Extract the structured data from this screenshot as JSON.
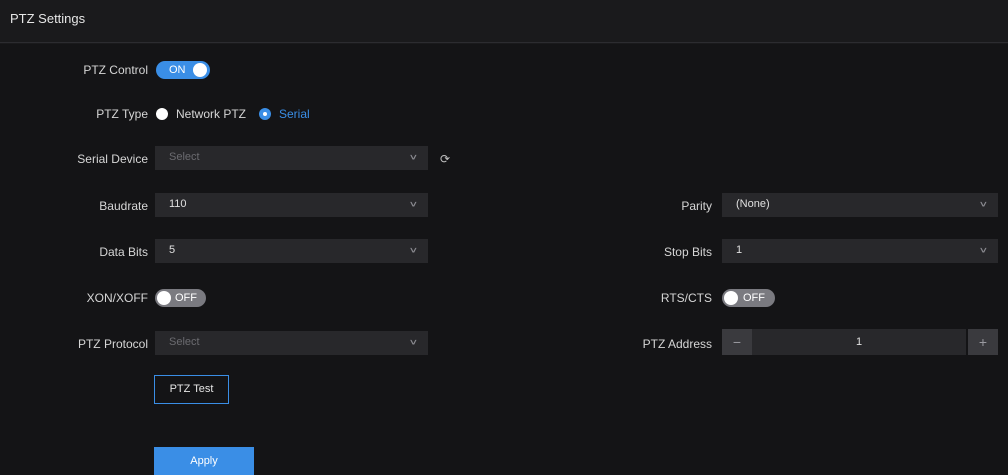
{
  "header": {
    "title": "PTZ Settings"
  },
  "ptz_control": {
    "label": "PTZ Control",
    "state": "ON"
  },
  "ptz_type": {
    "label": "PTZ Type",
    "options": [
      {
        "label": "Network PTZ",
        "selected": false
      },
      {
        "label": "Serial",
        "selected": true
      }
    ]
  },
  "serial_device": {
    "label": "Serial Device",
    "value": "Select"
  },
  "baudrate": {
    "label": "Baudrate",
    "value": "110"
  },
  "parity": {
    "label": "Parity",
    "value": "(None)"
  },
  "data_bits": {
    "label": "Data Bits",
    "value": "5"
  },
  "stop_bits": {
    "label": "Stop Bits",
    "value": "1"
  },
  "xon_xoff": {
    "label": "XON/XOFF",
    "state": "OFF"
  },
  "rts_cts": {
    "label": "RTS/CTS",
    "state": "OFF"
  },
  "ptz_protocol": {
    "label": "PTZ Protocol",
    "value": "Select"
  },
  "ptz_address": {
    "label": "PTZ Address",
    "value": "1",
    "minus": "−",
    "plus": "+"
  },
  "buttons": {
    "test": "PTZ Test",
    "apply": "Apply"
  },
  "icons": {
    "chevron": "chevron-down-icon",
    "refresh": "refresh-icon"
  },
  "colors": {
    "accent": "#3a8ee6",
    "background": "#141416",
    "field": "#28282b"
  }
}
